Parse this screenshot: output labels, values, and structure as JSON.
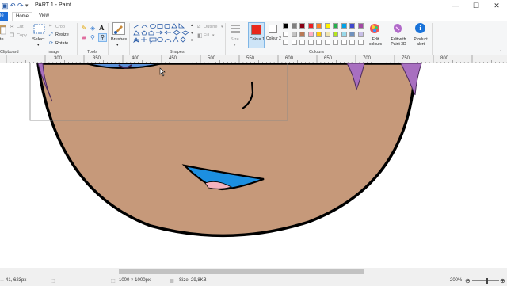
{
  "window": {
    "title": "PART 1 - Paint",
    "minimize": "—",
    "maximize": "☐",
    "close": "✕"
  },
  "tabs": {
    "file": "le",
    "home": "Home",
    "view": "View"
  },
  "ribbon": {
    "clipboard": {
      "paste": "te",
      "cut": "Cut",
      "copy": "Copy",
      "label": "Clipboard"
    },
    "image": {
      "select": "Select",
      "crop": "Crop",
      "resize": "Resize",
      "rotate": "Rotate",
      "label": "Image"
    },
    "tools": {
      "label": "Tools"
    },
    "brushes": {
      "label": "Brushes"
    },
    "shapes": {
      "outline": "Outline",
      "fill": "Fill",
      "label": "Shapes"
    },
    "size": {
      "label": "Size"
    },
    "colours": {
      "colour1": "Colour 1",
      "colour2": "Colour 2",
      "edit_colours": "Edit colours",
      "edit_paint3d": "Edit with Paint 3D",
      "product_alert": "Product alert",
      "label": "Colours",
      "colour1_value": "#e8281c",
      "colour2_value": "#ffffff",
      "palette_row1": [
        "#000000",
        "#7f7f7f",
        "#880015",
        "#ed1c24",
        "#ff7f27",
        "#fff200",
        "#22b14c",
        "#00a2e8",
        "#3f48cc",
        "#a349a4"
      ],
      "palette_row2": [
        "#ffffff",
        "#c3c3c3",
        "#b97a57",
        "#ffaec9",
        "#ffc90e",
        "#efe4b0",
        "#b5e61d",
        "#99d9ea",
        "#7092be",
        "#c8bfe7"
      ],
      "palette_row3": [
        "#ffffff",
        "#ffffff",
        "#ffffff",
        "#ffffff",
        "#ffffff",
        "#ffffff",
        "#ffffff",
        "#ffffff",
        "#ffffff",
        "#ffffff"
      ]
    }
  },
  "ruler": {
    "ticks": [
      "300",
      "350",
      "400",
      "450",
      "500",
      "550",
      "600",
      "650",
      "700",
      "750",
      "800"
    ]
  },
  "status": {
    "cursor_pos": "41, 623px",
    "dimensions": "1000 × 1000px",
    "file_size": "Size: 29,8KB",
    "zoom": "200%"
  }
}
